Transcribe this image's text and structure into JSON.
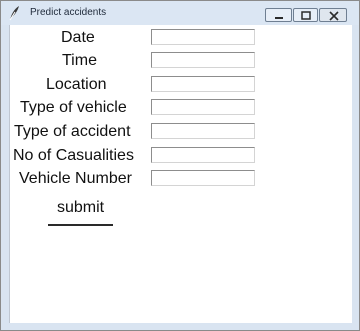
{
  "window": {
    "title": "Predict accidents",
    "controls": {
      "minimize_icon": "minimize-icon",
      "maximize_icon": "maximize-icon",
      "close_icon": "close-icon"
    },
    "app_icon": "feather-icon"
  },
  "form": {
    "fields": [
      {
        "label": "Date",
        "value": ""
      },
      {
        "label": "Time",
        "value": ""
      },
      {
        "label": "Location",
        "value": ""
      },
      {
        "label": "Type of vehicle",
        "value": ""
      },
      {
        "label": "Type of accident",
        "value": ""
      },
      {
        "label": "No of Casualities",
        "value": ""
      },
      {
        "label": "Vehicle Number",
        "value": ""
      }
    ],
    "submit_label": "submit"
  }
}
